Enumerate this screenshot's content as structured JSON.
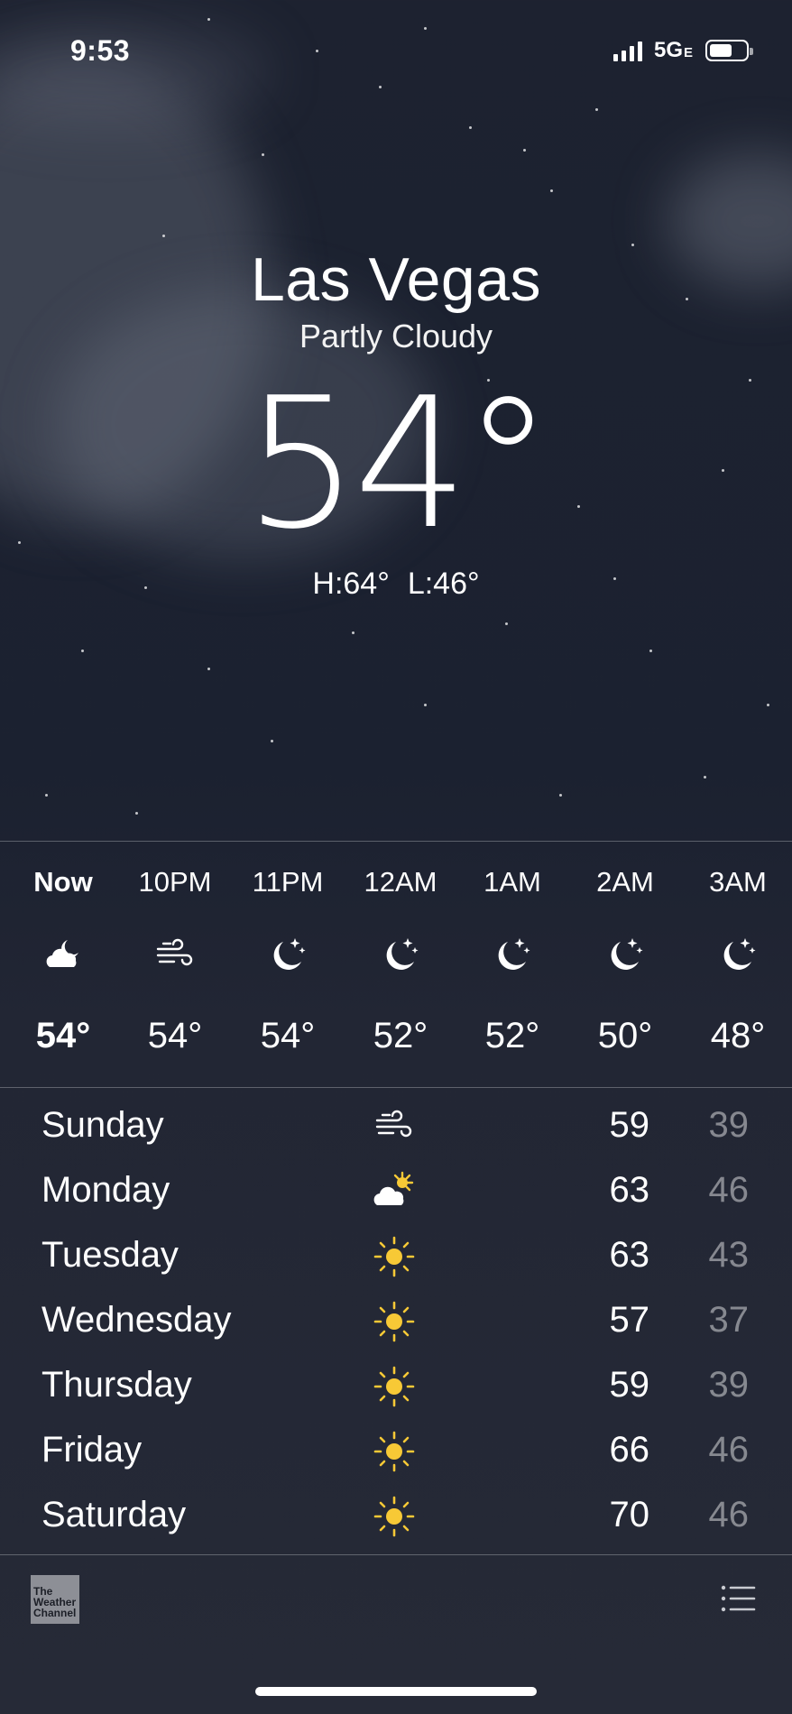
{
  "status_bar": {
    "time": "9:53",
    "network": "5G",
    "network_suffix": "E"
  },
  "location": {
    "city": "Las Vegas",
    "condition": "Partly Cloudy",
    "temperature": "54°",
    "high": "H:64°",
    "low": "L:46°"
  },
  "hourly": [
    {
      "label": "Now",
      "icon": "cloud-moon-icon",
      "temp": "54°"
    },
    {
      "label": "10PM",
      "icon": "wind-icon",
      "temp": "54°"
    },
    {
      "label": "11PM",
      "icon": "moon-stars-icon",
      "temp": "54°"
    },
    {
      "label": "12AM",
      "icon": "moon-stars-icon",
      "temp": "52°"
    },
    {
      "label": "1AM",
      "icon": "moon-stars-icon",
      "temp": "52°"
    },
    {
      "label": "2AM",
      "icon": "moon-stars-icon",
      "temp": "50°"
    },
    {
      "label": "3AM",
      "icon": "moon-stars-icon",
      "temp": "48°"
    }
  ],
  "daily": [
    {
      "day": "Sunday",
      "icon": "wind-icon",
      "high": "59",
      "low": "39"
    },
    {
      "day": "Monday",
      "icon": "cloud-sun-icon",
      "high": "63",
      "low": "46"
    },
    {
      "day": "Tuesday",
      "icon": "sun-icon",
      "high": "63",
      "low": "43"
    },
    {
      "day": "Wednesday",
      "icon": "sun-icon",
      "high": "57",
      "low": "37"
    },
    {
      "day": "Thursday",
      "icon": "sun-icon",
      "high": "59",
      "low": "39"
    },
    {
      "day": "Friday",
      "icon": "sun-icon",
      "high": "66",
      "low": "46"
    },
    {
      "day": "Saturday",
      "icon": "sun-icon",
      "high": "70",
      "low": "46"
    }
  ],
  "footer": {
    "logo_text": "The Weather Channel",
    "logo_line1": "The",
    "logo_line2": "Weather",
    "logo_line3": "Channel",
    "list_icon": "list-icon"
  },
  "colors": {
    "sun": "#f7c936",
    "low_temp": "rgba(255,255,255,0.45)",
    "background": "#1d2230"
  }
}
